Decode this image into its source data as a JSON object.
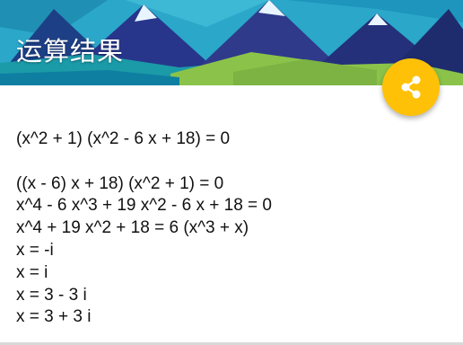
{
  "header": {
    "title": "运算结果",
    "share_icon": "share-icon"
  },
  "colors": {
    "fab": "#ffc107",
    "sky": "#2aa7c9",
    "mountain_dark": "#2f3a8a",
    "meadow": "#8bc34a"
  },
  "result": {
    "lines": [
      "(x^2 + 1) (x^2 - 6 x + 18) = 0",
      "",
      "((x - 6) x + 18) (x^2 + 1) = 0",
      "x^4 - 6 x^3 + 19 x^2 - 6 x + 18 = 0",
      "x^4 + 19 x^2 + 18 = 6 (x^3 + x)",
      "x = -i",
      "x = i",
      "x = 3 - 3 i",
      "x = 3 + 3 i"
    ]
  }
}
